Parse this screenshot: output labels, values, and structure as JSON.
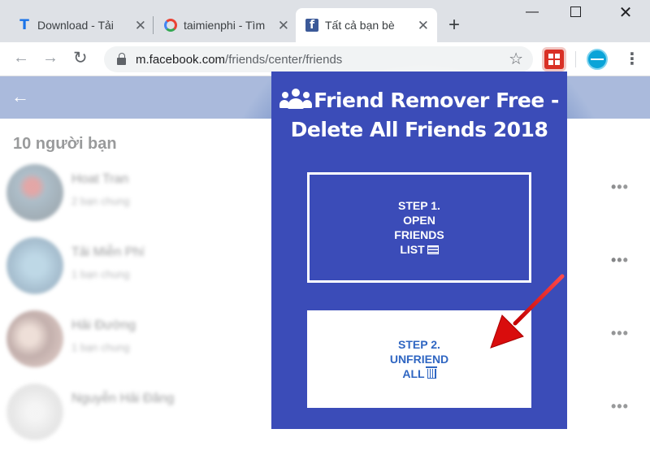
{
  "browser": {
    "tabs": [
      {
        "title": "Download - Tải",
        "favicon": "taimienphi-t-icon",
        "active": false
      },
      {
        "title": "taimienphi - Tìm",
        "favicon": "google-g-icon",
        "active": false
      },
      {
        "title": "Tất cả bạn bè",
        "favicon": "facebook-f-icon",
        "active": true
      }
    ],
    "url_host": "m.facebook.com",
    "url_path": "/friends/center/friends"
  },
  "facebook": {
    "friends_count": "10 người bạn",
    "friends": [
      {
        "name": "Hoat Tran",
        "mutual": "2 bạn chung"
      },
      {
        "name": "Tải Miễn Phí",
        "mutual": "1 bạn chung"
      },
      {
        "name": "Hải Đường",
        "mutual": "1 bạn chung"
      },
      {
        "name": "Nguyễn Hải Đăng",
        "mutual": ""
      }
    ]
  },
  "extension": {
    "title": "Friend Remover Free - Delete All Friends 2018",
    "step1_label": "STEP 1.\nOPEN\nFRIENDS\nLIST",
    "step2_label": "STEP 2.\nUNFRIEND\nALL",
    "colors": {
      "panel": "#3b4cb8",
      "step2_text": "#2f66c2",
      "arrow": "#e02020"
    }
  }
}
